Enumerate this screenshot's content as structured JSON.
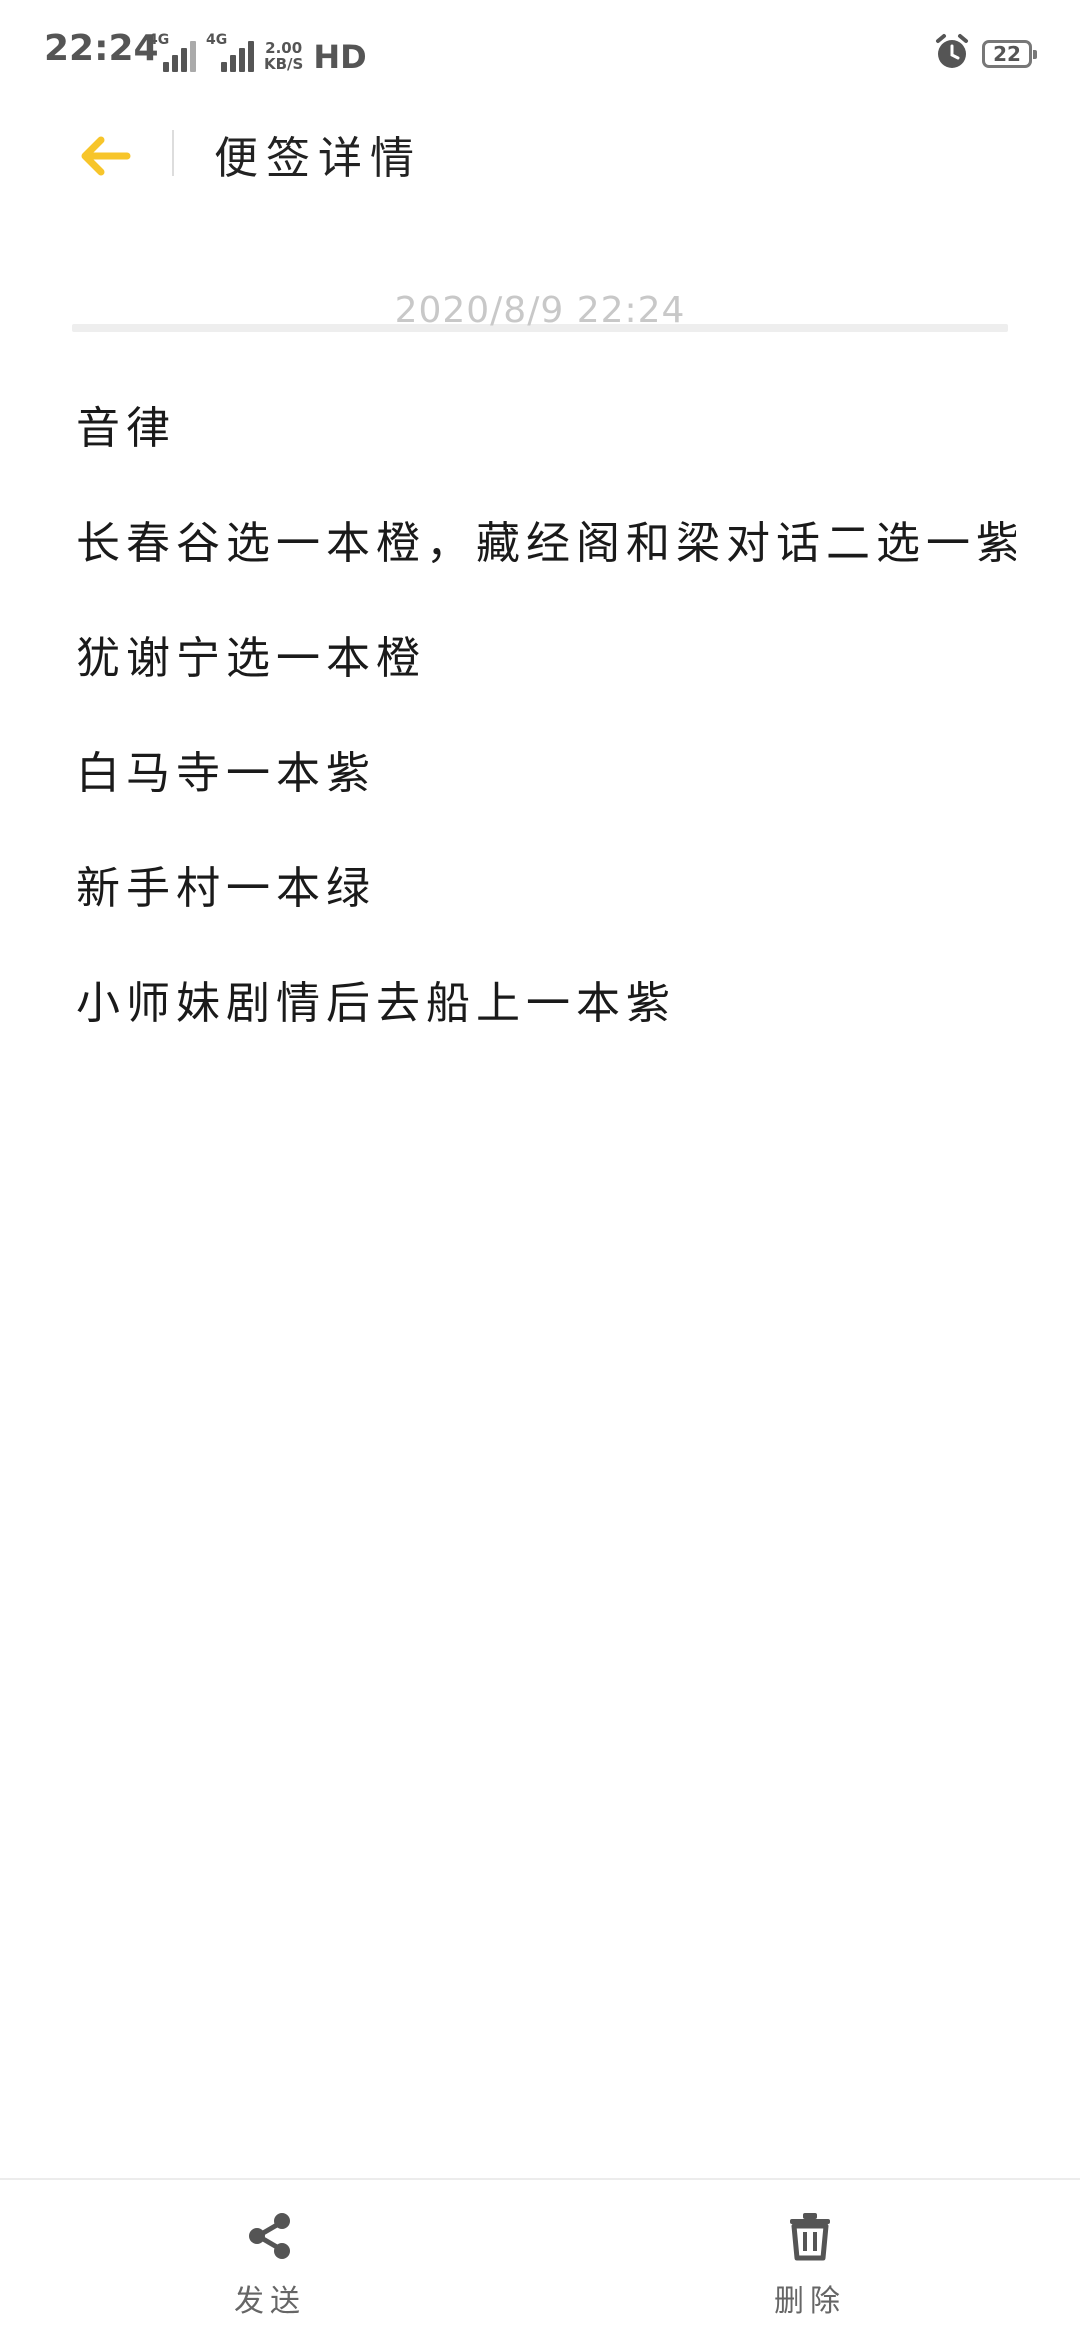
{
  "status_bar": {
    "time": "22:24",
    "signal1_tag": "4G",
    "signal2_tag": "4G",
    "net_speed_value": "2.00",
    "net_speed_unit": "KB/S",
    "hd_label": "HD",
    "battery_level": "22",
    "icons": [
      "signal-icon",
      "signal-icon",
      "alarm-icon",
      "battery-icon"
    ]
  },
  "header": {
    "title": "便签详情",
    "back_icon": "arrow-left-icon",
    "accent_color": "#F7C52A"
  },
  "note": {
    "date": "2020/8/9 22:24",
    "lines": [
      "音律",
      "长春谷选一本橙，藏经阁和梁对话二选一紫",
      "犹谢宁选一本橙",
      "白马寺一本紫",
      "新手村一本绿",
      "小师妹剧情后去船上一本紫"
    ]
  },
  "bottom_bar": {
    "send_label": "发送",
    "delete_label": "删除",
    "send_icon": "share-icon",
    "delete_icon": "trash-icon"
  }
}
